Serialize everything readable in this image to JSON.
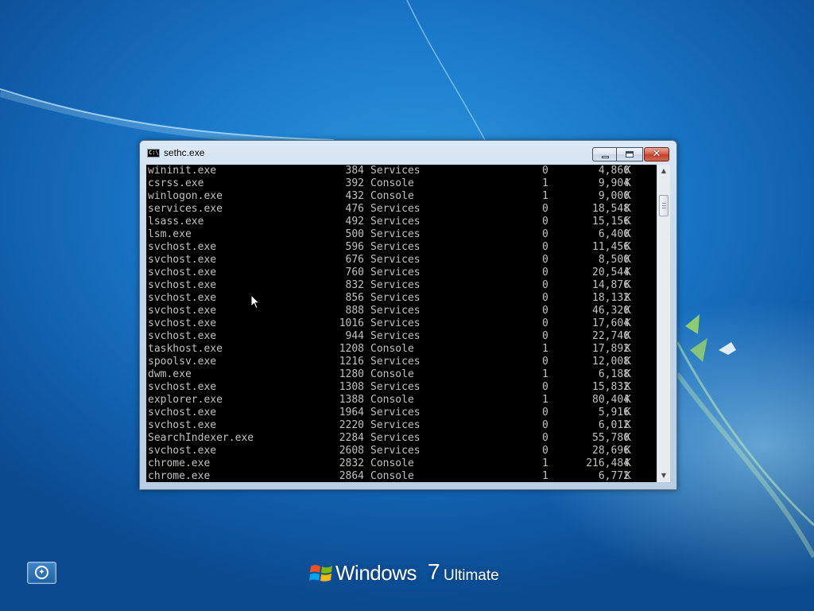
{
  "window": {
    "title": "sethc.exe",
    "icon_text": "C:\\",
    "close_glyph": "✕"
  },
  "processes": [
    {
      "name": "wininit.exe",
      "pid": "384",
      "session": "Services",
      "session_num": "0",
      "mem": "4,860",
      "unit": "K"
    },
    {
      "name": "csrss.exe",
      "pid": "392",
      "session": "Console",
      "session_num": "1",
      "mem": "9,904",
      "unit": "K"
    },
    {
      "name": "winlogon.exe",
      "pid": "432",
      "session": "Console",
      "session_num": "1",
      "mem": "9,000",
      "unit": "K"
    },
    {
      "name": "services.exe",
      "pid": "476",
      "session": "Services",
      "session_num": "0",
      "mem": "18,548",
      "unit": "K"
    },
    {
      "name": "lsass.exe",
      "pid": "492",
      "session": "Services",
      "session_num": "0",
      "mem": "15,156",
      "unit": "K"
    },
    {
      "name": "lsm.exe",
      "pid": "500",
      "session": "Services",
      "session_num": "0",
      "mem": "6,400",
      "unit": "K"
    },
    {
      "name": "svchost.exe",
      "pid": "596",
      "session": "Services",
      "session_num": "0",
      "mem": "11,456",
      "unit": "K"
    },
    {
      "name": "svchost.exe",
      "pid": "676",
      "session": "Services",
      "session_num": "0",
      "mem": "8,500",
      "unit": "K"
    },
    {
      "name": "svchost.exe",
      "pid": "760",
      "session": "Services",
      "session_num": "0",
      "mem": "20,544",
      "unit": "K"
    },
    {
      "name": "svchost.exe",
      "pid": "832",
      "session": "Services",
      "session_num": "0",
      "mem": "14,876",
      "unit": "K"
    },
    {
      "name": "svchost.exe",
      "pid": "856",
      "session": "Services",
      "session_num": "0",
      "mem": "18,132",
      "unit": "K"
    },
    {
      "name": "svchost.exe",
      "pid": "888",
      "session": "Services",
      "session_num": "0",
      "mem": "46,320",
      "unit": "K"
    },
    {
      "name": "svchost.exe",
      "pid": "1016",
      "session": "Services",
      "session_num": "0",
      "mem": "17,604",
      "unit": "K"
    },
    {
      "name": "svchost.exe",
      "pid": "944",
      "session": "Services",
      "session_num": "0",
      "mem": "22,740",
      "unit": "K"
    },
    {
      "name": "taskhost.exe",
      "pid": "1208",
      "session": "Console",
      "session_num": "1",
      "mem": "17,892",
      "unit": "K"
    },
    {
      "name": "spoolsv.exe",
      "pid": "1216",
      "session": "Services",
      "session_num": "0",
      "mem": "12,008",
      "unit": "K"
    },
    {
      "name": "dwm.exe",
      "pid": "1280",
      "session": "Console",
      "session_num": "1",
      "mem": "6,188",
      "unit": "K"
    },
    {
      "name": "svchost.exe",
      "pid": "1308",
      "session": "Services",
      "session_num": "0",
      "mem": "15,832",
      "unit": "K"
    },
    {
      "name": "explorer.exe",
      "pid": "1388",
      "session": "Console",
      "session_num": "1",
      "mem": "80,404",
      "unit": "K"
    },
    {
      "name": "svchost.exe",
      "pid": "1964",
      "session": "Services",
      "session_num": "0",
      "mem": "5,916",
      "unit": "K"
    },
    {
      "name": "svchost.exe",
      "pid": "2220",
      "session": "Services",
      "session_num": "0",
      "mem": "6,012",
      "unit": "K"
    },
    {
      "name": "SearchIndexer.exe",
      "pid": "2284",
      "session": "Services",
      "session_num": "0",
      "mem": "55,780",
      "unit": "K"
    },
    {
      "name": "svchost.exe",
      "pid": "2608",
      "session": "Services",
      "session_num": "0",
      "mem": "28,696",
      "unit": "K"
    },
    {
      "name": "chrome.exe",
      "pid": "2832",
      "session": "Console",
      "session_num": "1",
      "mem": "216,484",
      "unit": "K"
    },
    {
      "name": "chrome.exe",
      "pid": "2864",
      "session": "Console",
      "session_num": "1",
      "mem": "6,772",
      "unit": "K"
    }
  ],
  "scrollbar": {
    "up_glyph": "▲",
    "down_glyph": "▼"
  },
  "branding": {
    "name": "Windows",
    "version": "7",
    "edition": "Ultimate"
  },
  "colors": {
    "console_bg": "#000000",
    "console_text": "#c0c0c0",
    "desktop_blue": "#1a78c8"
  }
}
